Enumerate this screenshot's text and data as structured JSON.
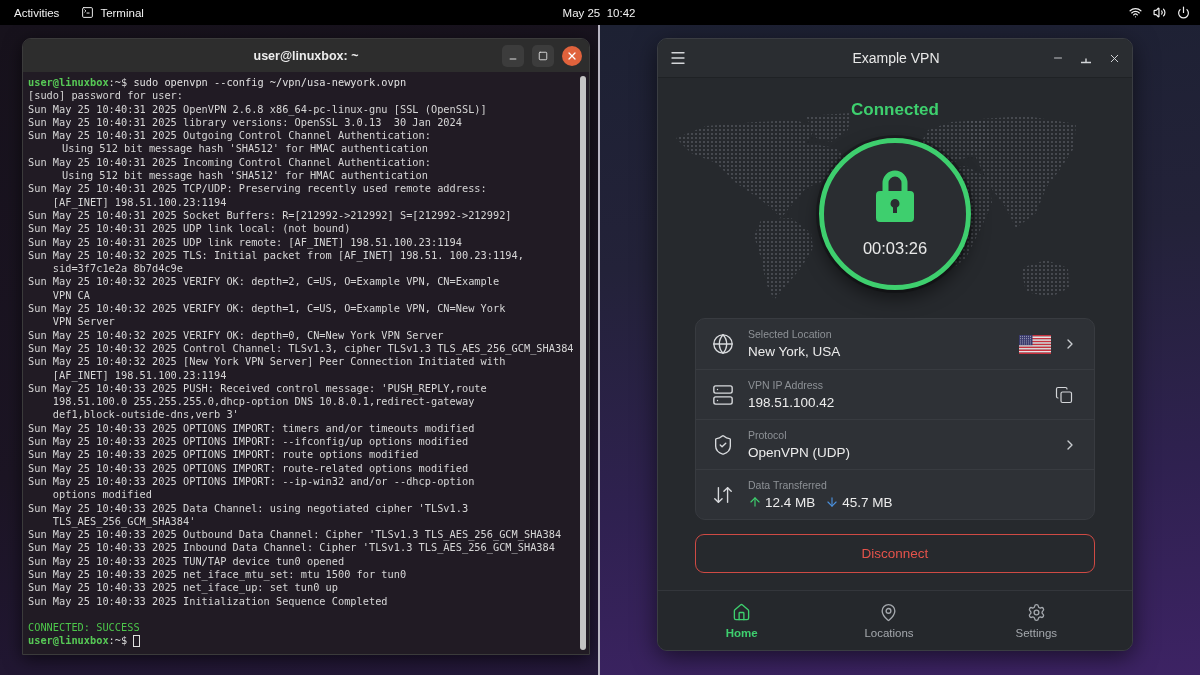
{
  "top_bar": {
    "activities": "Activities",
    "app": "Terminal",
    "clock": "May 25  10:42"
  },
  "terminal": {
    "title": "user@linuxbox: ~",
    "lines": [
      {
        "kind": "prompt",
        "user": "user@linuxbox",
        "path": ":~$",
        "command": "sudo openvpn --config ~/vpn/usa-newyork.ovpn"
      },
      {
        "kind": "output",
        "text": "[sudo] password for user:"
      },
      {
        "kind": "output",
        "text": "Sun May 25 10:40:31 2025 OpenVPN 2.6.8 x86_64-pc-linux-gnu [SSL (OpenSSL)]"
      },
      {
        "kind": "output",
        "text": "Sun May 25 10:40:31 2025 library versions: OpenSSL 3.0.13  30 Jan 2024"
      },
      {
        "kind": "output",
        "text": "Sun May 25 10:40:31 2025 Outgoing Control Channel Authentication:"
      },
      {
        "kind": "detail",
        "text": "Using 512 bit message hash 'SHA512' for HMAC authentication"
      },
      {
        "kind": "output",
        "text": "Sun May 25 10:40:31 2025 Incoming Control Channel Authentication:"
      },
      {
        "kind": "detail",
        "text": "Using 512 bit message hash 'SHA512' for HMAC authentication"
      },
      {
        "kind": "output",
        "text": "Sun May 25 10:40:31 2025 TCP/UDP: Preserving recently used remote address:"
      },
      {
        "kind": "continuation",
        "text": "[AF_INET] 198.51.100.23:1194"
      },
      {
        "kind": "output",
        "text": "Sun May 25 10:40:31 2025 Socket Buffers: R=[212992->212992] S=[212992->212992]"
      },
      {
        "kind": "output",
        "text": "Sun May 25 10:40:31 2025 UDP link local: (not bound)"
      },
      {
        "kind": "output",
        "text": "Sun May 25 10:40:31 2025 UDP link remote: [AF_INET] 198.51.100.23:1194"
      },
      {
        "kind": "output",
        "text": "Sun May 25 10:40:32 2025 TLS: Initial packet from [AF_INET] 198.51. 100.23:1194,"
      },
      {
        "kind": "continuation",
        "text": "sid=3f7c1e2a 8b7d4c9e"
      },
      {
        "kind": "output",
        "text": "Sun May 25 10:40:32 2025 VERIFY OK: depth=2, C=US, O=Example VPN, CN=Example"
      },
      {
        "kind": "continuation",
        "text": "VPN CA"
      },
      {
        "kind": "output",
        "text": "Sun May 25 10:40:32 2025 VERIFY OK: depth=1, C=US, O=Example VPN, CN=New York"
      },
      {
        "kind": "continuation",
        "text": "VPN Server"
      },
      {
        "kind": "output",
        "text": "Sun May 25 10:40:32 2025 VERIFY OK: depth=0, CN=New York VPN Server"
      },
      {
        "kind": "output",
        "text": "Sun May 25 10:40:32 2025 Control Channel: TLSv1.3, cipher TLSv1.3 TLS_AES_256_GCM_SHA384"
      },
      {
        "kind": "output",
        "text": "Sun May 25 10:40:32 2025 [New York VPN Server] Peer Connection Initiated with"
      },
      {
        "kind": "continuation",
        "text": "[AF_INET] 198.51.100.23:1194"
      },
      {
        "kind": "output",
        "text": "Sun May 25 10:40:33 2025 PUSH: Received control message: 'PUSH_REPLY,route"
      },
      {
        "kind": "continuation",
        "text": "198.51.100.0 255.255.255.0,dhcp-option DNS 10.8.0.1,redirect-gateway"
      },
      {
        "kind": "continuation",
        "text": "def1,block-outside-dns,verb 3'"
      },
      {
        "kind": "output",
        "text": "Sun May 25 10:40:33 2025 OPTIONS IMPORT: timers and/or timeouts modified"
      },
      {
        "kind": "output",
        "text": "Sun May 25 10:40:33 2025 OPTIONS IMPORT: --ifconfig/up options modified"
      },
      {
        "kind": "output",
        "text": "Sun May 25 10:40:33 2025 OPTIONS IMPORT: route options modified"
      },
      {
        "kind": "output",
        "text": "Sun May 25 10:40:33 2025 OPTIONS IMPORT: route-related options modified"
      },
      {
        "kind": "output",
        "text": "Sun May 25 10:40:33 2025 OPTIONS IMPORT: --ip-win32 and/or --dhcp-option"
      },
      {
        "kind": "continuation",
        "text": "options modified"
      },
      {
        "kind": "output",
        "text": "Sun May 25 10:40:33 2025 Data Channel: using negotiated cipher 'TLSv1.3"
      },
      {
        "kind": "continuation",
        "text": "TLS_AES_256_GCM_SHA384'"
      },
      {
        "kind": "output",
        "text": "Sun May 25 10:40:33 2025 Outbound Data Channel: Cipher 'TLSv1.3 TLS_AES_256_GCM_SHA384"
      },
      {
        "kind": "output",
        "text": "Sun May 25 10:40:33 2025 Inbound Data Channel: Cipher 'TLSv1.3 TLS_AES_256_GCM_SHA384"
      },
      {
        "kind": "output",
        "text": "Sun May 25 10:40:33 2025 TUN/TAP device tun0 opened"
      },
      {
        "kind": "output",
        "text": "Sun May 25 10:40:33 2025 net_iface_mtu_set: mtu 1500 for tun0"
      },
      {
        "kind": "output",
        "text": "Sun May 25 10:40:33 2025 net_iface_up: set tun0 up"
      },
      {
        "kind": "output",
        "text": "Sun May 25 10:40:33 2025 Initialization Sequence Completed"
      },
      {
        "kind": "blank"
      },
      {
        "kind": "success",
        "text": "CONNECTED: SUCCESS"
      },
      {
        "kind": "prompt",
        "user": "user@linuxbox",
        "path": ":~$",
        "cursor": true
      }
    ]
  },
  "vpn": {
    "title": "Example VPN",
    "status": "Connected",
    "connected": true,
    "timer": "00:03:26",
    "info": [
      {
        "kind": "location",
        "label": "Selected Location",
        "value": "New York, USA"
      },
      {
        "kind": "ip",
        "label": "VPN IP Address",
        "value": "198.51.100.42"
      },
      {
        "kind": "protocol",
        "label": "Protocol",
        "value": "OpenVPN (UDP)"
      },
      {
        "kind": "transfer",
        "label": "Data Transferred",
        "upload": "12.4 MB",
        "download": "45.7 MB"
      }
    ],
    "disconnect": "Disconnect",
    "nav": [
      {
        "kind": "home",
        "label": "Home",
        "selected": true
      },
      {
        "kind": "locations",
        "label": "Locations",
        "selected": false
      },
      {
        "kind": "settings",
        "label": "Settings",
        "selected": false
      }
    ]
  }
}
